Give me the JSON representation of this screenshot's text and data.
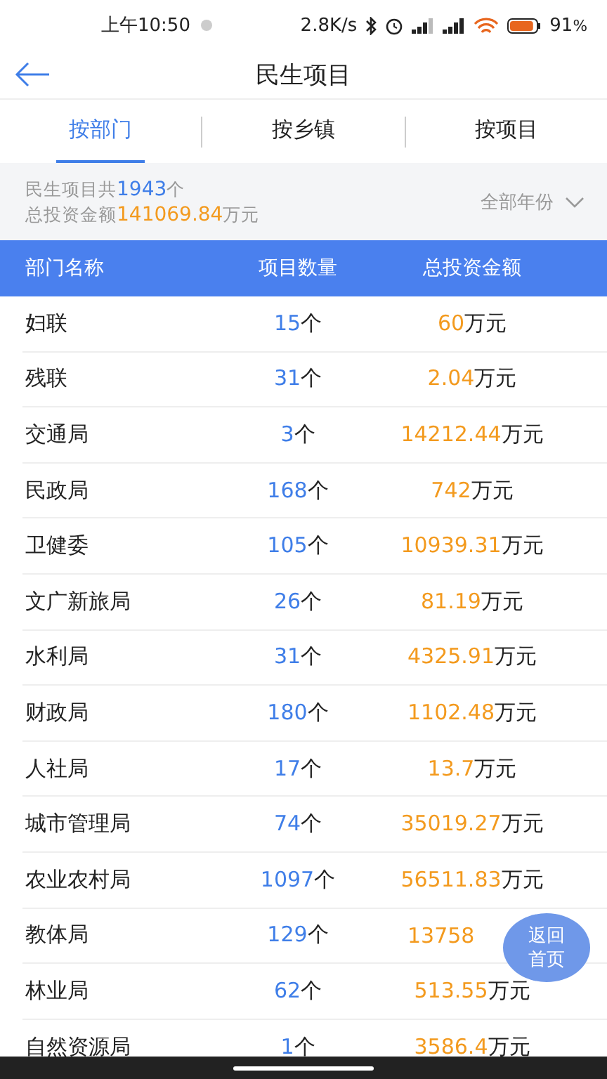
{
  "status_bar": {
    "time": "上午10:50",
    "speed": "2.8K/s",
    "battery": "91",
    "battery_unit": "%"
  },
  "header": {
    "title": "民生项目"
  },
  "tabs": [
    {
      "label": "按部门",
      "selected": true
    },
    {
      "label": "按乡镇",
      "selected": false
    },
    {
      "label": "按项目",
      "selected": false
    }
  ],
  "summary": {
    "count_prefix": "民生项目共",
    "count": "1943",
    "count_unit": "个",
    "total_prefix": "总投资金额",
    "total": "141069.84",
    "total_unit": "万元",
    "year_filter": "全部年份"
  },
  "table": {
    "columns": [
      "部门名称",
      "项目数量",
      "总投资金额"
    ],
    "rows": [
      {
        "name": "妇联",
        "count": "15",
        "count_unit": "个",
        "amount": "60",
        "amount_unit": "万元"
      },
      {
        "name": "残联",
        "count": "31",
        "count_unit": "个",
        "amount": "2.04",
        "amount_unit": "万元"
      },
      {
        "name": "交通局",
        "count": "3",
        "count_unit": "个",
        "amount": "14212.44",
        "amount_unit": "万元"
      },
      {
        "name": "民政局",
        "count": "168",
        "count_unit": "个",
        "amount": "742",
        "amount_unit": "万元"
      },
      {
        "name": "卫健委",
        "count": "105",
        "count_unit": "个",
        "amount": "10939.31",
        "amount_unit": "万元"
      },
      {
        "name": "文广新旅局",
        "count": "26",
        "count_unit": "个",
        "amount": "81.19",
        "amount_unit": "万元"
      },
      {
        "name": "水利局",
        "count": "31",
        "count_unit": "个",
        "amount": "4325.91",
        "amount_unit": "万元"
      },
      {
        "name": "财政局",
        "count": "180",
        "count_unit": "个",
        "amount": "1102.48",
        "amount_unit": "万元"
      },
      {
        "name": "人社局",
        "count": "17",
        "count_unit": "个",
        "amount": "13.7",
        "amount_unit": "万元"
      },
      {
        "name": "城市管理局",
        "count": "74",
        "count_unit": "个",
        "amount": "35019.27",
        "amount_unit": "万元"
      },
      {
        "name": "农业农村局",
        "count": "1097",
        "count_unit": "个",
        "amount": "56511.83",
        "amount_unit": "万元"
      },
      {
        "name": "教体局",
        "count": "129",
        "count_unit": "个",
        "amount": "13758"
      },
      {
        "name": "林业局",
        "count": "62",
        "count_unit": "个",
        "amount": "513.55",
        "amount_unit": "万元"
      },
      {
        "name": "自然资源局",
        "count": "1",
        "count_unit": "个",
        "amount": "3586.4",
        "amount_unit": "万元"
      }
    ]
  },
  "float_button": {
    "label": "返回首页"
  }
}
